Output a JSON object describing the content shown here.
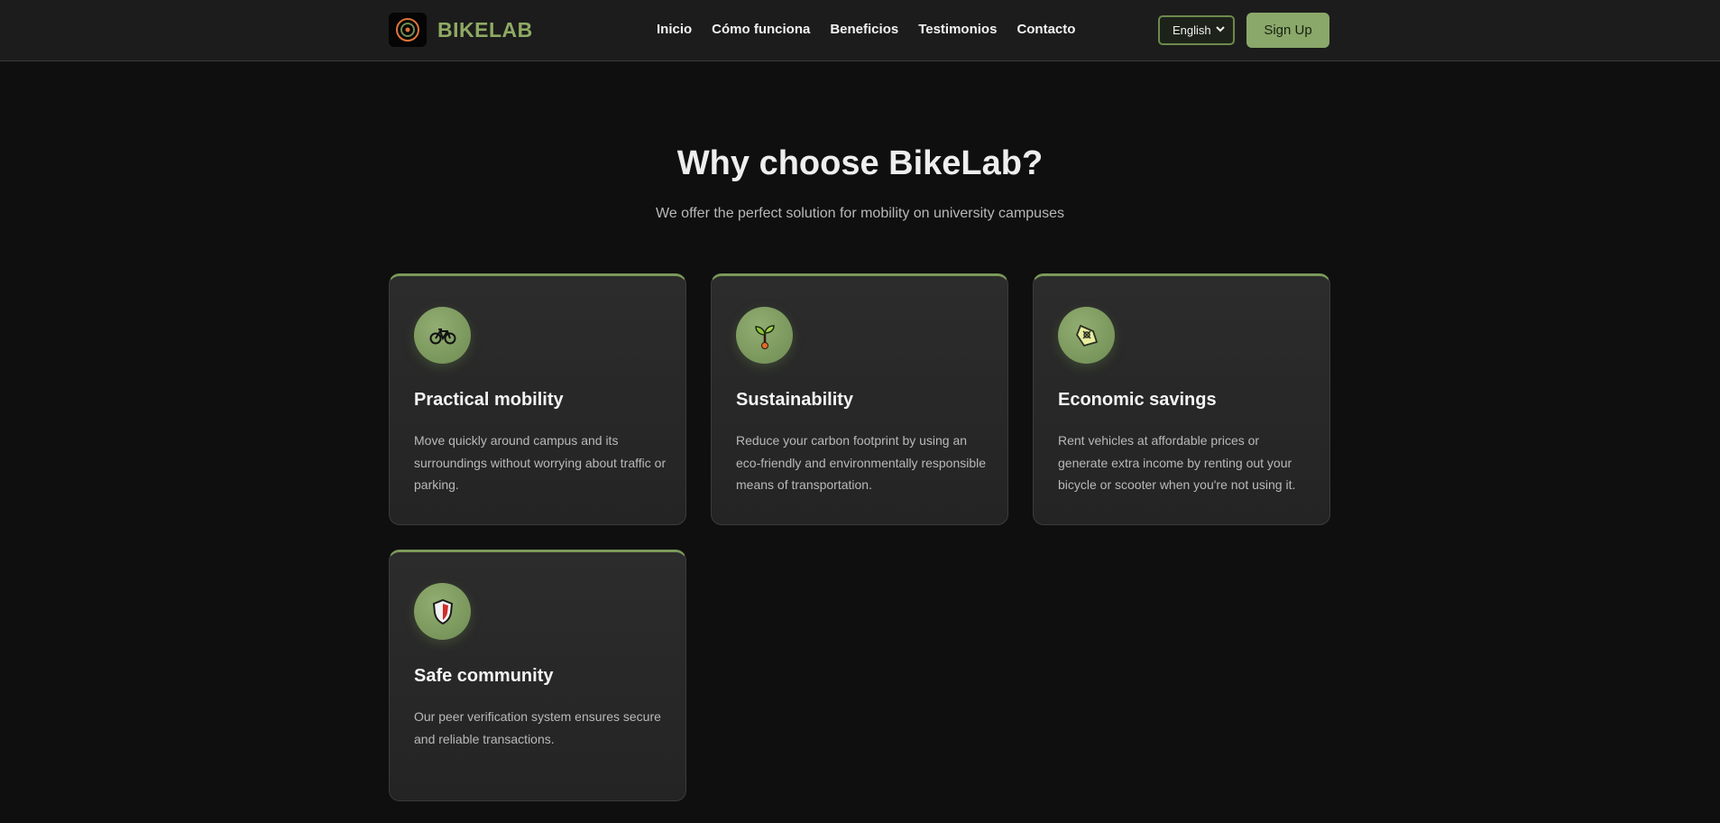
{
  "header": {
    "brand": "BIKELAB",
    "nav": [
      "Inicio",
      "Cómo funciona",
      "Beneficios",
      "Testimonios",
      "Contacto"
    ],
    "language": "English",
    "signup_label": "Sign Up"
  },
  "hero": {
    "title": "Why choose BikeLab?",
    "subtitle": "We offer the perfect solution for mobility on university campuses"
  },
  "cards": [
    {
      "icon": "bicycle-icon",
      "title": "Practical mobility",
      "desc": "Move quickly around campus and its surroundings without worrying about traffic or parking."
    },
    {
      "icon": "seedling-icon",
      "title": "Sustainability",
      "desc": "Reduce your carbon footprint by using an eco-friendly and environmentally responsible means of transportation."
    },
    {
      "icon": "money-icon",
      "title": "Economic savings",
      "desc": "Rent vehicles at affordable prices or generate extra income by renting out your bicycle or scooter when you're not using it."
    },
    {
      "icon": "shield-icon",
      "title": "Safe community",
      "desc": "Our peer verification system ensures secure and reliable transactions."
    }
  ],
  "colors": {
    "accent": "#8aa86a",
    "background": "#0f0f0f",
    "card": "#2a2a2a"
  }
}
